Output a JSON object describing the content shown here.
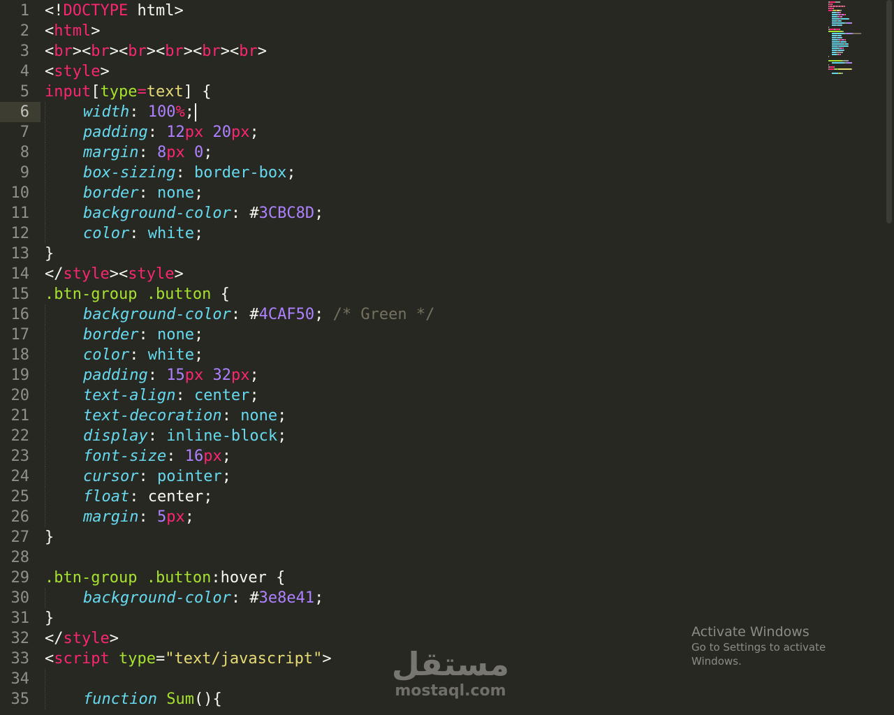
{
  "current_line": 6,
  "lines": [
    {
      "n": "1",
      "tokens": [
        {
          "t": "<!",
          "c": "plain"
        },
        {
          "t": "DOCTYPE",
          "c": "tag"
        },
        {
          "t": " html>",
          "c": "plain"
        }
      ]
    },
    {
      "n": "2",
      "tokens": [
        {
          "t": "<",
          "c": "plain"
        },
        {
          "t": "html",
          "c": "tag"
        },
        {
          "t": ">",
          "c": "plain"
        }
      ]
    },
    {
      "n": "3",
      "tokens": [
        {
          "t": "<",
          "c": "plain"
        },
        {
          "t": "br",
          "c": "tag"
        },
        {
          "t": "><",
          "c": "plain"
        },
        {
          "t": "br",
          "c": "tag"
        },
        {
          "t": "><",
          "c": "plain"
        },
        {
          "t": "br",
          "c": "tag"
        },
        {
          "t": "><",
          "c": "plain"
        },
        {
          "t": "br",
          "c": "tag"
        },
        {
          "t": "><",
          "c": "plain"
        },
        {
          "t": "br",
          "c": "tag"
        },
        {
          "t": "><",
          "c": "plain"
        },
        {
          "t": "br",
          "c": "tag"
        },
        {
          "t": ">",
          "c": "plain"
        }
      ]
    },
    {
      "n": "4",
      "tokens": [
        {
          "t": "<",
          "c": "plain"
        },
        {
          "t": "style",
          "c": "tag"
        },
        {
          "t": ">",
          "c": "plain"
        }
      ]
    },
    {
      "n": "5",
      "tokens": [
        {
          "t": "input",
          "c": "tag"
        },
        {
          "t": "[",
          "c": "plain"
        },
        {
          "t": "type",
          "c": "attr"
        },
        {
          "t": "=",
          "c": "tag"
        },
        {
          "t": "text",
          "c": "str"
        },
        {
          "t": "] {",
          "c": "plain"
        }
      ]
    },
    {
      "n": "6",
      "indent": true,
      "caret": true,
      "tokens": [
        {
          "t": "width",
          "c": "prop"
        },
        {
          "t": ": ",
          "c": "plain"
        },
        {
          "t": "100",
          "c": "num"
        },
        {
          "t": "%",
          "c": "unit"
        },
        {
          "t": ";",
          "c": "plain"
        }
      ]
    },
    {
      "n": "7",
      "indent": true,
      "tokens": [
        {
          "t": "padding",
          "c": "prop"
        },
        {
          "t": ": ",
          "c": "plain"
        },
        {
          "t": "12",
          "c": "num"
        },
        {
          "t": "px",
          "c": "unit"
        },
        {
          "t": " ",
          "c": "plain"
        },
        {
          "t": "20",
          "c": "num"
        },
        {
          "t": "px",
          "c": "unit"
        },
        {
          "t": ";",
          "c": "plain"
        }
      ]
    },
    {
      "n": "8",
      "indent": true,
      "tokens": [
        {
          "t": "margin",
          "c": "prop"
        },
        {
          "t": ": ",
          "c": "plain"
        },
        {
          "t": "8",
          "c": "num"
        },
        {
          "t": "px",
          "c": "unit"
        },
        {
          "t": " ",
          "c": "plain"
        },
        {
          "t": "0",
          "c": "num"
        },
        {
          "t": ";",
          "c": "plain"
        }
      ]
    },
    {
      "n": "9",
      "indent": true,
      "tokens": [
        {
          "t": "box-sizing",
          "c": "prop"
        },
        {
          "t": ": ",
          "c": "plain"
        },
        {
          "t": "border-box",
          "c": "val"
        },
        {
          "t": ";",
          "c": "plain"
        }
      ]
    },
    {
      "n": "10",
      "indent": true,
      "tokens": [
        {
          "t": "border",
          "c": "prop"
        },
        {
          "t": ": ",
          "c": "plain"
        },
        {
          "t": "none",
          "c": "val"
        },
        {
          "t": ";",
          "c": "plain"
        }
      ]
    },
    {
      "n": "11",
      "indent": true,
      "tokens": [
        {
          "t": "background-color",
          "c": "prop"
        },
        {
          "t": ": ",
          "c": "plain"
        },
        {
          "t": "#",
          "c": "plain"
        },
        {
          "t": "3CBC8D",
          "c": "num"
        },
        {
          "t": ";",
          "c": "plain"
        }
      ]
    },
    {
      "n": "12",
      "indent": true,
      "tokens": [
        {
          "t": "color",
          "c": "prop"
        },
        {
          "t": ": ",
          "c": "plain"
        },
        {
          "t": "white",
          "c": "val"
        },
        {
          "t": ";",
          "c": "plain"
        }
      ]
    },
    {
      "n": "13",
      "tokens": [
        {
          "t": "}",
          "c": "plain"
        }
      ]
    },
    {
      "n": "14",
      "tokens": [
        {
          "t": "</",
          "c": "plain"
        },
        {
          "t": "style",
          "c": "tag"
        },
        {
          "t": "><",
          "c": "plain"
        },
        {
          "t": "style",
          "c": "tag"
        },
        {
          "t": ">",
          "c": "plain"
        }
      ]
    },
    {
      "n": "15",
      "tokens": [
        {
          "t": ".btn-group .button",
          "c": "sel"
        },
        {
          "t": " {",
          "c": "plain"
        }
      ]
    },
    {
      "n": "16",
      "indent": true,
      "tokens": [
        {
          "t": "background-color",
          "c": "prop"
        },
        {
          "t": ": ",
          "c": "plain"
        },
        {
          "t": "#",
          "c": "plain"
        },
        {
          "t": "4CAF50",
          "c": "num"
        },
        {
          "t": "; ",
          "c": "plain"
        },
        {
          "t": "/* Green */",
          "c": "comment"
        }
      ]
    },
    {
      "n": "17",
      "indent": true,
      "tokens": [
        {
          "t": "border",
          "c": "prop"
        },
        {
          "t": ": ",
          "c": "plain"
        },
        {
          "t": "none",
          "c": "val"
        },
        {
          "t": ";",
          "c": "plain"
        }
      ]
    },
    {
      "n": "18",
      "indent": true,
      "tokens": [
        {
          "t": "color",
          "c": "prop"
        },
        {
          "t": ": ",
          "c": "plain"
        },
        {
          "t": "white",
          "c": "val"
        },
        {
          "t": ";",
          "c": "plain"
        }
      ]
    },
    {
      "n": "19",
      "indent": true,
      "tokens": [
        {
          "t": "padding",
          "c": "prop"
        },
        {
          "t": ": ",
          "c": "plain"
        },
        {
          "t": "15",
          "c": "num"
        },
        {
          "t": "px",
          "c": "unit"
        },
        {
          "t": " ",
          "c": "plain"
        },
        {
          "t": "32",
          "c": "num"
        },
        {
          "t": "px",
          "c": "unit"
        },
        {
          "t": ";",
          "c": "plain"
        }
      ]
    },
    {
      "n": "20",
      "indent": true,
      "tokens": [
        {
          "t": "text-align",
          "c": "prop"
        },
        {
          "t": ": ",
          "c": "plain"
        },
        {
          "t": "center",
          "c": "val"
        },
        {
          "t": ";",
          "c": "plain"
        }
      ]
    },
    {
      "n": "21",
      "indent": true,
      "tokens": [
        {
          "t": "text-decoration",
          "c": "prop"
        },
        {
          "t": ": ",
          "c": "plain"
        },
        {
          "t": "none",
          "c": "val"
        },
        {
          "t": ";",
          "c": "plain"
        }
      ]
    },
    {
      "n": "22",
      "indent": true,
      "tokens": [
        {
          "t": "display",
          "c": "prop"
        },
        {
          "t": ": ",
          "c": "plain"
        },
        {
          "t": "inline-block",
          "c": "val"
        },
        {
          "t": ";",
          "c": "plain"
        }
      ]
    },
    {
      "n": "23",
      "indent": true,
      "tokens": [
        {
          "t": "font-size",
          "c": "prop"
        },
        {
          "t": ": ",
          "c": "plain"
        },
        {
          "t": "16",
          "c": "num"
        },
        {
          "t": "px",
          "c": "unit"
        },
        {
          "t": ";",
          "c": "plain"
        }
      ]
    },
    {
      "n": "24",
      "indent": true,
      "tokens": [
        {
          "t": "cursor",
          "c": "prop"
        },
        {
          "t": ": ",
          "c": "plain"
        },
        {
          "t": "pointer",
          "c": "val"
        },
        {
          "t": ";",
          "c": "plain"
        }
      ]
    },
    {
      "n": "25",
      "indent": true,
      "tokens": [
        {
          "t": "float",
          "c": "prop"
        },
        {
          "t": ": ",
          "c": "plain"
        },
        {
          "t": "center",
          "c": "plain"
        },
        {
          "t": ";",
          "c": "plain"
        }
      ]
    },
    {
      "n": "26",
      "indent": true,
      "tokens": [
        {
          "t": "margin",
          "c": "prop"
        },
        {
          "t": ": ",
          "c": "plain"
        },
        {
          "t": "5",
          "c": "num"
        },
        {
          "t": "px",
          "c": "unit"
        },
        {
          "t": ";",
          "c": "plain"
        }
      ]
    },
    {
      "n": "27",
      "tokens": [
        {
          "t": "}",
          "c": "plain"
        }
      ]
    },
    {
      "n": "28",
      "tokens": []
    },
    {
      "n": "29",
      "tokens": [
        {
          "t": ".btn-group .button",
          "c": "sel"
        },
        {
          "t": ":hover",
          "c": "plain"
        },
        {
          "t": " {",
          "c": "plain"
        }
      ]
    },
    {
      "n": "30",
      "indent": true,
      "tokens": [
        {
          "t": "background-color",
          "c": "prop"
        },
        {
          "t": ": ",
          "c": "plain"
        },
        {
          "t": "#",
          "c": "plain"
        },
        {
          "t": "3e8e41",
          "c": "num"
        },
        {
          "t": ";",
          "c": "plain"
        }
      ]
    },
    {
      "n": "31",
      "tokens": [
        {
          "t": "}",
          "c": "plain"
        }
      ]
    },
    {
      "n": "32",
      "tokens": [
        {
          "t": "</",
          "c": "plain"
        },
        {
          "t": "style",
          "c": "tag"
        },
        {
          "t": ">",
          "c": "plain"
        }
      ]
    },
    {
      "n": "33",
      "tokens": [
        {
          "t": "<",
          "c": "plain"
        },
        {
          "t": "script",
          "c": "tag"
        },
        {
          "t": " ",
          "c": "plain"
        },
        {
          "t": "type",
          "c": "attr"
        },
        {
          "t": "=",
          "c": "plain"
        },
        {
          "t": "\"text/javascript\"",
          "c": "str"
        },
        {
          "t": ">",
          "c": "plain"
        }
      ]
    },
    {
      "n": "34",
      "indent": true,
      "tokens": []
    },
    {
      "n": "35",
      "indent": true,
      "tokens": [
        {
          "t": "function",
          "c": "kw"
        },
        {
          "t": " ",
          "c": "plain"
        },
        {
          "t": "Sum",
          "c": "fn"
        },
        {
          "t": "(){",
          "c": "plain"
        }
      ]
    }
  ],
  "watermark_windows": {
    "title": "Activate Windows",
    "subtitle": "Go to Settings to activate Windows."
  },
  "watermark_brand": {
    "arabic": "مستقل",
    "latin": "mostaql.com"
  },
  "colors": {
    "background": "#272822",
    "tag": "#f92672",
    "selector": "#a6e22e",
    "string": "#e6db74",
    "property": "#66d9ef",
    "number": "#ae81ff",
    "comment": "#75715e",
    "text": "#f8f8f2"
  }
}
